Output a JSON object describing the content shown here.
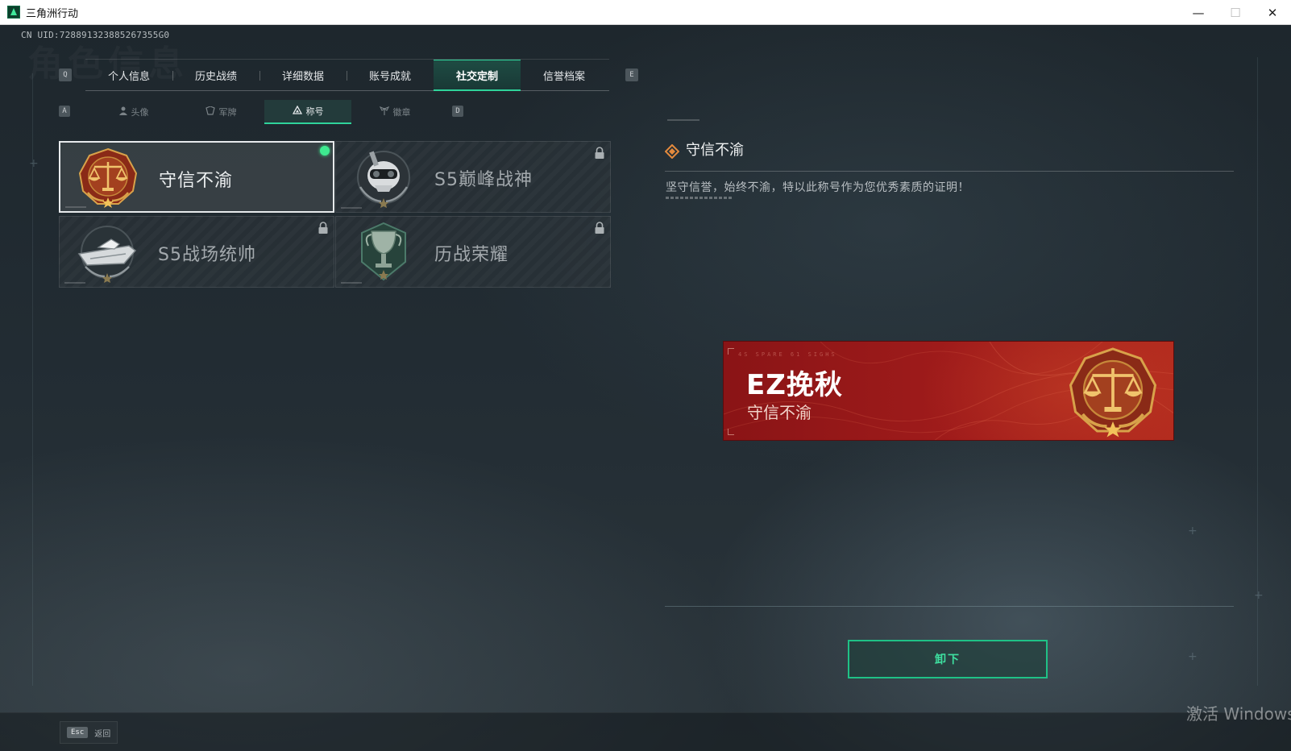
{
  "window": {
    "title": "三角洲行动",
    "min": "—",
    "max": "☐",
    "close": "✕"
  },
  "game": {
    "uid": "CN UID:728891323885267355G0",
    "ghost_title": "角色信息",
    "main_tabs": {
      "prev_key": "Q",
      "next_key": "E",
      "items": [
        {
          "label": "个人信息"
        },
        {
          "label": "历史战绩"
        },
        {
          "label": "详细数据"
        },
        {
          "label": "账号成就"
        },
        {
          "label": "社交定制",
          "active": true
        },
        {
          "label": "信誉档案"
        }
      ]
    },
    "sub_tabs": {
      "prev_key": "A",
      "next_key": "D",
      "items": [
        {
          "label": "头像",
          "icon": "person-icon"
        },
        {
          "label": "军牌",
          "icon": "dogtag-icon"
        },
        {
          "label": "称号",
          "icon": "triangle-icon",
          "active": true
        },
        {
          "label": "徽章",
          "icon": "wing-icon"
        }
      ]
    },
    "titles": [
      {
        "label": "守信不渝",
        "badge": "scales-badge",
        "selected": true,
        "equipped": true
      },
      {
        "label": "S5巅峰战神",
        "badge": "skull-badge",
        "locked": true
      },
      {
        "label": "S5战场统帅",
        "badge": "boat-badge",
        "locked": true
      },
      {
        "label": "历战荣耀",
        "badge": "trophy-badge",
        "locked": true
      }
    ],
    "detail": {
      "title": "守信不渝",
      "description": "坚守信誉，始终不渝，特以此称号作为您优秀素质的证明！"
    },
    "nameplate": {
      "code": "4S SPARE 61 SIGHS",
      "player_name": "EZ挽秋",
      "title": "守信不渝"
    },
    "unequip_label": "卸下",
    "footer": {
      "esc_key": "Esc",
      "esc_label": "返回"
    },
    "watermark": "激活 Windows"
  },
  "colors": {
    "accent_green": "#2fd39a",
    "equipped_dot": "#3ee98f",
    "nameplate_red": "#a11c1b",
    "badge_gold": "#d8a24a"
  }
}
